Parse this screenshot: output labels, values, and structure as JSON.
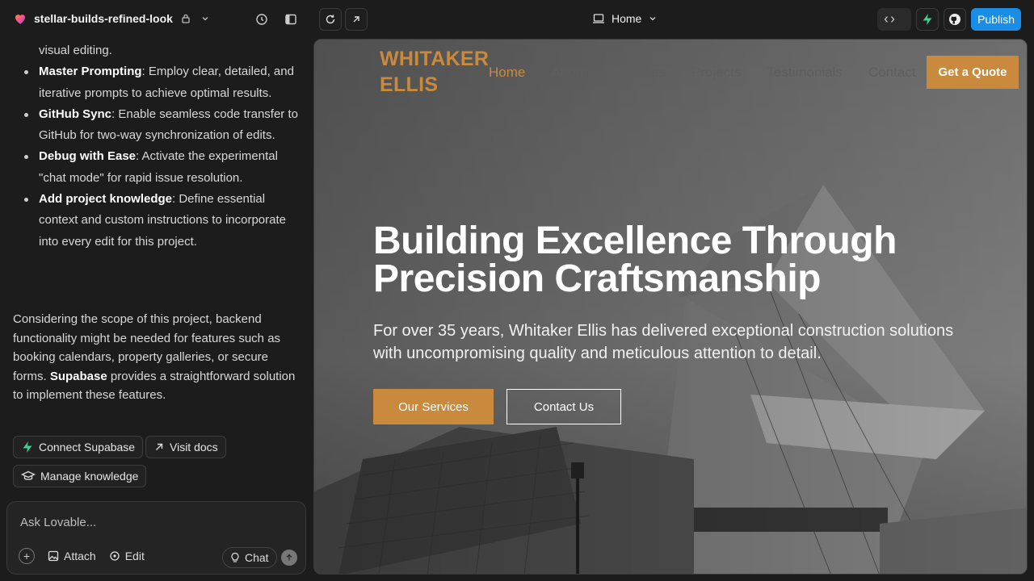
{
  "topbar": {
    "project_name": "stellar-builds-refined-look",
    "route": "Home",
    "publish": "Publish"
  },
  "chat": {
    "items": [
      {
        "bold": "",
        "text": "visual editing."
      },
      {
        "bold": "Master Prompting",
        "text": ": Employ clear, detailed, and iterative prompts to achieve optimal results."
      },
      {
        "bold": "GitHub Sync",
        "text": ": Enable seamless code transfer to GitHub for two-way synchronization of edits."
      },
      {
        "bold": "Debug with Ease",
        "text": ": Activate the experimental \"chat mode\" for rapid issue resolution."
      },
      {
        "bold": "Add project knowledge",
        "text": ": Define essential context and custom instructions to incorporate into every edit for this project."
      }
    ],
    "para_before": "Considering the scope of this project, backend functionality might be needed for features such as booking calendars, property galleries, or secure forms.",
    "para_bold": "Supabase",
    "para_after": "provides a straightforward solution to implement these features.",
    "connect_supabase": "Connect Supabase",
    "visit_docs": "Visit docs",
    "manage_knowledge": "Manage knowledge",
    "input_placeholder": "Ask Lovable...",
    "attach": "Attach",
    "edit": "Edit",
    "chat_mode": "Chat"
  },
  "site": {
    "brand_line1": "WHITAKER",
    "brand_line2": "ELLIS",
    "nav": [
      "Home",
      "About",
      "Services",
      "Projects",
      "Testimonials",
      "Contact"
    ],
    "quote": "Get a Quote",
    "hero_title": "Building Excellence Through Precision Craftsmanship",
    "hero_sub": "For over 35 years, Whitaker Ellis has delivered exceptional construction solutions with uncompromising quality and meticulous attention to detail.",
    "btn_services": "Our Services",
    "btn_contact": "Contact Us"
  },
  "colors": {
    "accent": "#c98a3e",
    "publish": "#1a8ee6",
    "supabase": "#3ecf8e"
  }
}
